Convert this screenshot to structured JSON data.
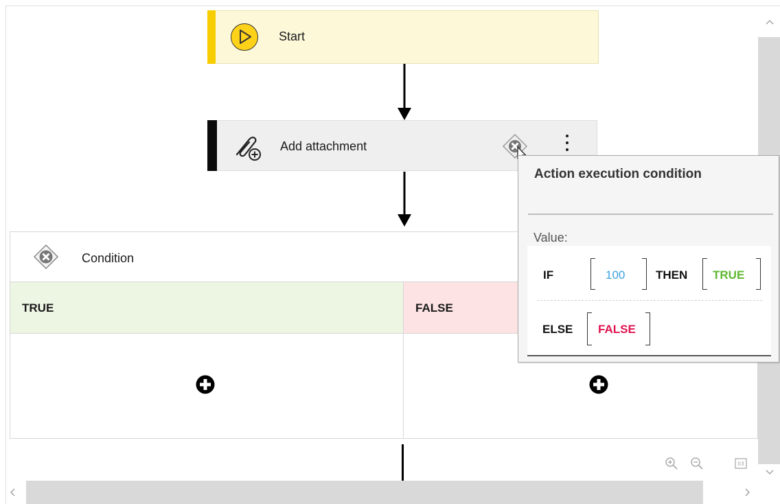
{
  "flow": {
    "start": {
      "label": "Start"
    },
    "action": {
      "label": "Add attachment"
    },
    "condition": {
      "label": "Condition",
      "branches": [
        {
          "label": "TRUE",
          "color": "#edf5e3"
        },
        {
          "label": "FALSE",
          "color": "#fde3e3"
        }
      ]
    }
  },
  "popup": {
    "title": "Action execution condition",
    "value_label": "Value:",
    "expression": {
      "if_kw": "IF",
      "if_value": "100",
      "then_kw": "THEN",
      "then_value": "TRUE",
      "else_kw": "ELSE",
      "else_value": "FALSE"
    }
  },
  "colors": {
    "start_accent": "#f7cd00",
    "action_accent": "#0a0a0a",
    "if_value": "#3da0e0",
    "then_value": "#5cb82e",
    "else_value": "#e0134f"
  },
  "toolbar": {
    "icons": [
      "zoom-in-icon",
      "zoom-out-icon",
      "actual-size-icon"
    ]
  }
}
